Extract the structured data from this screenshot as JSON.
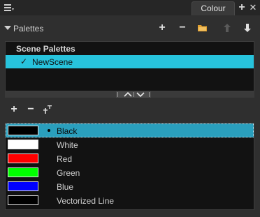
{
  "header": {
    "tab_label": "Colour",
    "add_tab_glyph": "+",
    "close_glyph": "✕",
    "menu_icon": "hamburger-menu-icon"
  },
  "palettes": {
    "label": "Palettes",
    "toolbar": {
      "add_glyph": "+",
      "remove_glyph": "−",
      "import_icon": "folder-icon",
      "move_up_icon": "arrow-up-icon",
      "move_down_icon": "arrow-down-icon"
    },
    "list": {
      "header": "Scene Palettes",
      "items": [
        {
          "name": "NewScene",
          "check": "✓",
          "selected": true
        }
      ]
    }
  },
  "colour_toolbar": {
    "add_glyph": "+",
    "remove_glyph": "−",
    "rename_glyph": "ᵀ"
  },
  "swatches": [
    {
      "name": "Black",
      "color": "#000000",
      "selected": true
    },
    {
      "name": "White",
      "color": "#ffffff",
      "selected": false
    },
    {
      "name": "Red",
      "color": "#ff0000",
      "selected": false
    },
    {
      "name": "Green",
      "color": "#00ff00",
      "selected": false
    },
    {
      "name": "Blue",
      "color": "#0000ff",
      "selected": false
    },
    {
      "name": "Vectorized Line",
      "color": "#000000",
      "selected": false
    }
  ],
  "colors": {
    "accent": "#27c3dc",
    "selected_row": "#2a9fbd",
    "panel_bg": "#2f2f2f",
    "list_bg": "#121212"
  }
}
